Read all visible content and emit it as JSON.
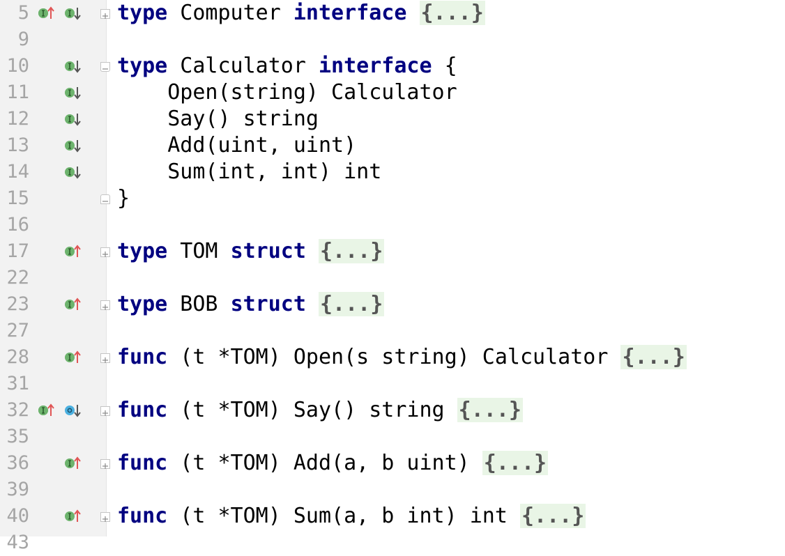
{
  "editor": {
    "lines": [
      {
        "num": "5",
        "has_row": true,
        "markers": [
          "implemented",
          "implements-up",
          "implemented-down"
        ],
        "fold": "collapsed",
        "code": [
          {
            "t": "type",
            "kw": true
          },
          {
            "t": " Computer "
          },
          {
            "t": "interface",
            "kw": true
          },
          {
            "t": " "
          },
          {
            "t": "{...}",
            "fold": true
          }
        ]
      },
      {
        "num": "9",
        "markers": [],
        "fold": "",
        "code": []
      },
      {
        "num": "10",
        "markers": [
          "implemented-down"
        ],
        "fold": "expanded",
        "code": [
          {
            "t": "type",
            "kw": true
          },
          {
            "t": " Calculator "
          },
          {
            "t": "interface",
            "kw": true
          },
          {
            "t": " {"
          }
        ]
      },
      {
        "num": "11",
        "markers": [
          "implemented-down"
        ],
        "fold": "",
        "code": [
          {
            "t": "    Open(string) Calculator"
          }
        ]
      },
      {
        "num": "12",
        "markers": [
          "implemented-down"
        ],
        "fold": "",
        "code": [
          {
            "t": "    Say() string"
          }
        ]
      },
      {
        "num": "13",
        "markers": [
          "implemented-down"
        ],
        "fold": "",
        "code": [
          {
            "t": "    Add(uint, uint)"
          }
        ]
      },
      {
        "num": "14",
        "markers": [
          "implemented-down"
        ],
        "fold": "",
        "code": [
          {
            "t": "    Sum(int, int) int"
          }
        ]
      },
      {
        "num": "15",
        "markers": [],
        "fold": "end",
        "code": [
          {
            "t": "}"
          }
        ]
      },
      {
        "num": "16",
        "markers": [],
        "fold": "",
        "code": []
      },
      {
        "num": "17",
        "markers": [
          "implements-up"
        ],
        "fold": "collapsed",
        "code": [
          {
            "t": "type",
            "kw": true
          },
          {
            "t": " TOM "
          },
          {
            "t": "struct",
            "kw": true
          },
          {
            "t": " "
          },
          {
            "t": "{...}",
            "fold": true
          }
        ]
      },
      {
        "num": "22",
        "markers": [],
        "fold": "",
        "code": []
      },
      {
        "num": "23",
        "markers": [
          "implements-up"
        ],
        "fold": "collapsed",
        "code": [
          {
            "t": "type",
            "kw": true
          },
          {
            "t": " BOB "
          },
          {
            "t": "struct",
            "kw": true
          },
          {
            "t": " "
          },
          {
            "t": "{...}",
            "fold": true
          }
        ]
      },
      {
        "num": "27",
        "markers": [],
        "fold": "",
        "code": []
      },
      {
        "num": "28",
        "markers": [
          "implements-up"
        ],
        "fold": "collapsed",
        "code": [
          {
            "t": "func",
            "kw": true
          },
          {
            "t": " (t *TOM) Open(s string) Calculator "
          },
          {
            "t": "{...}",
            "fold": true
          }
        ]
      },
      {
        "num": "31",
        "markers": [],
        "fold": "",
        "code": []
      },
      {
        "num": "32",
        "markers": [
          "implemented",
          "implements-up",
          "overrides-down"
        ],
        "fold": "collapsed",
        "code": [
          {
            "t": "func",
            "kw": true
          },
          {
            "t": " (t *TOM) Say() string "
          },
          {
            "t": "{...}",
            "fold": true
          }
        ]
      },
      {
        "num": "35",
        "markers": [],
        "fold": "",
        "code": []
      },
      {
        "num": "36",
        "markers": [
          "implements-up"
        ],
        "fold": "collapsed",
        "code": [
          {
            "t": "func",
            "kw": true
          },
          {
            "t": " (t *TOM) Add(a, b uint) "
          },
          {
            "t": "{...}",
            "fold": true
          }
        ]
      },
      {
        "num": "39",
        "markers": [],
        "fold": "",
        "code": []
      },
      {
        "num": "40",
        "markers": [
          "implements-up"
        ],
        "fold": "collapsed",
        "code": [
          {
            "t": "func",
            "kw": true
          },
          {
            "t": " (t *TOM) Sum(a, b int) int "
          },
          {
            "t": "{...}",
            "fold": true
          }
        ]
      },
      {
        "num": "43",
        "markers": [],
        "fold": "",
        "code": []
      }
    ]
  },
  "colors": {
    "keyword": "#000080",
    "gutter_bg": "#f2f2f2",
    "fold_placeholder_bg": "#e9f5e6",
    "marker_green": "#6db36d",
    "marker_blue": "#4bb0e0",
    "arrow_red": "#e05555",
    "arrow_gray": "#555555"
  },
  "icons": {
    "implemented": "implemented-interface-icon",
    "implements-up": "implements-method-up-arrow-icon",
    "implemented-down": "has-implementations-down-arrow-icon",
    "overrides-down": "overridden-method-down-arrow-icon"
  }
}
